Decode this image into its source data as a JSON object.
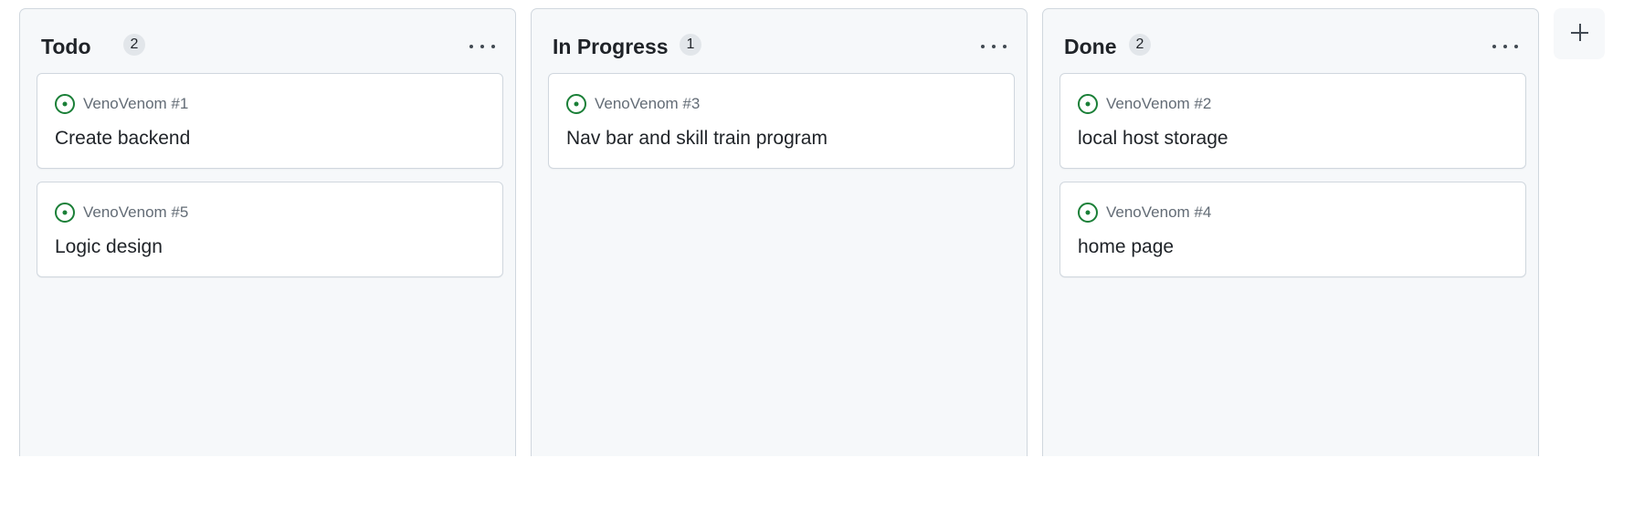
{
  "columns": [
    {
      "title": "Todo",
      "count": "2",
      "cards": [
        {
          "ref": "VenoVenom #1",
          "title": "Create backend"
        },
        {
          "ref": "VenoVenom #5",
          "title": "Logic design"
        }
      ]
    },
    {
      "title": "In Progress",
      "count": "1",
      "cards": [
        {
          "ref": "VenoVenom #3",
          "title": "Nav bar and skill train program"
        }
      ]
    },
    {
      "title": "Done",
      "count": "2",
      "cards": [
        {
          "ref": "VenoVenom #2",
          "title": "local host storage"
        },
        {
          "ref": "VenoVenom #4",
          "title": "home page"
        }
      ]
    }
  ],
  "icons": {
    "issue": "issue-opened-icon",
    "menu": "kebab-horizontal-icon",
    "add": "plus-icon"
  },
  "colors": {
    "issue_open": "#1a7f37",
    "column_bg": "#f6f8fa",
    "border": "#d0d7de",
    "muted_text": "#636c76"
  }
}
